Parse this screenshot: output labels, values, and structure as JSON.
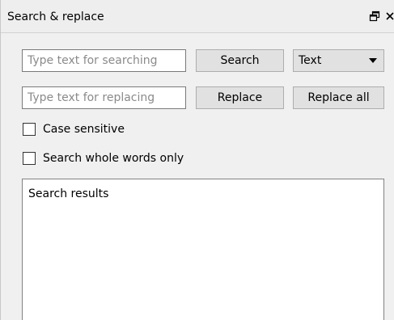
{
  "panel": {
    "title": "Search & replace"
  },
  "search": {
    "placeholder": "Type text for searching",
    "value": "",
    "button_label": "Search",
    "mode_selected": "Text"
  },
  "replace": {
    "placeholder": "Type text for replacing",
    "value": "",
    "button_label": "Replace",
    "all_button_label": "Replace all"
  },
  "options": {
    "case_sensitive_label": "Case sensitive",
    "case_sensitive_checked": false,
    "whole_words_label": "Search whole words only",
    "whole_words_checked": false
  },
  "results": {
    "label": "Search results"
  },
  "icons": {
    "float": "float-window-icon",
    "close": "close-icon",
    "dropdown": "chevron-down-icon"
  }
}
